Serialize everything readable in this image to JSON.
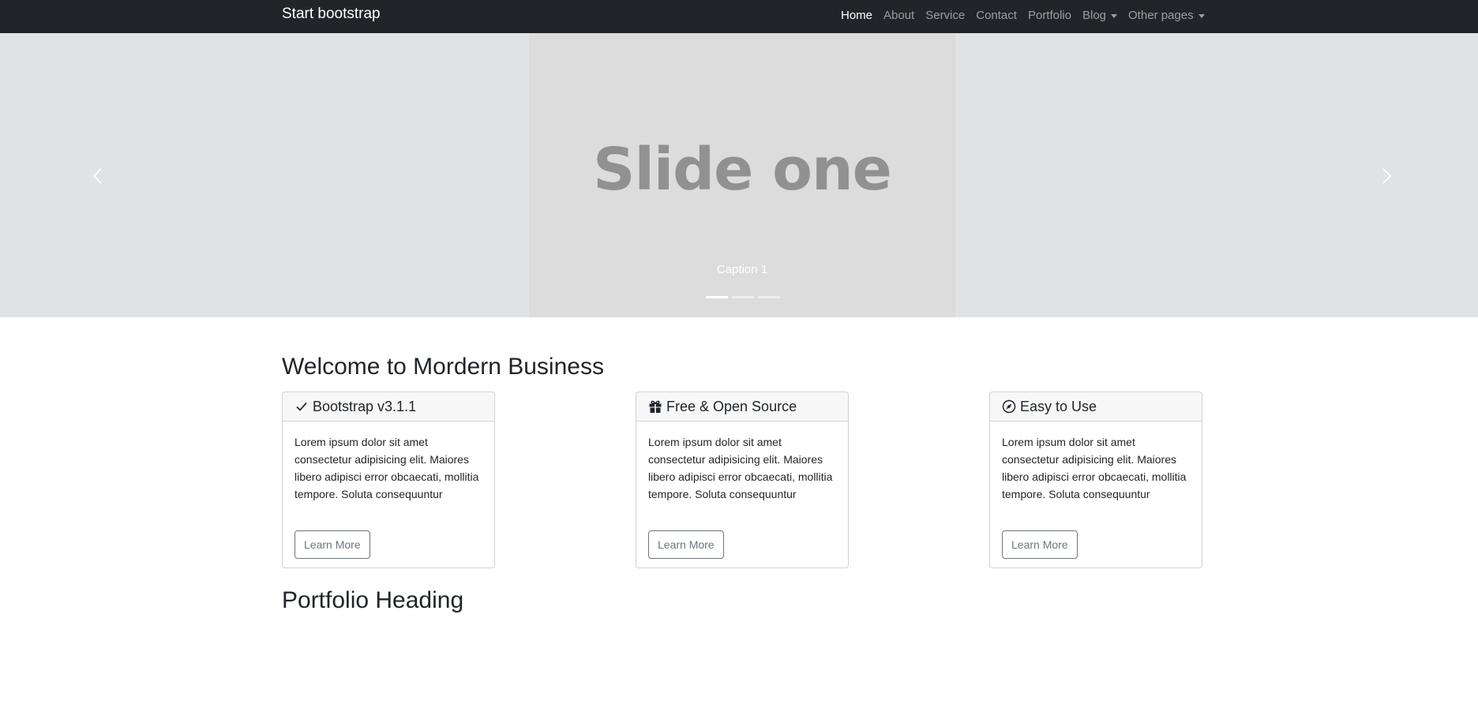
{
  "navbar": {
    "brand": "Start bootstrap",
    "items": [
      {
        "label": "Home",
        "active": true,
        "dropdown": false
      },
      {
        "label": "About",
        "active": false,
        "dropdown": false
      },
      {
        "label": "Service",
        "active": false,
        "dropdown": false
      },
      {
        "label": "Contact",
        "active": false,
        "dropdown": false
      },
      {
        "label": "Portfolio",
        "active": false,
        "dropdown": false
      },
      {
        "label": "Blog",
        "active": false,
        "dropdown": true
      },
      {
        "label": "Other pages",
        "active": false,
        "dropdown": true
      }
    ]
  },
  "carousel": {
    "slide_text": "Slide one",
    "caption": "Caption 1",
    "slide_count": 3,
    "active_index": 0,
    "prev_icon": "chevron-left-icon",
    "next_icon": "chevron-right-icon"
  },
  "main": {
    "heading": "Welcome to Mordern Business",
    "cards": [
      {
        "icon": "check-icon",
        "title": "Bootstrap v3.1.1",
        "text": "Lorem ipsum dolor sit amet consectetur adipisicing elit. Maiores libero adipisci error obcaecati, mollitia tempore. Soluta consequuntur",
        "button": "Learn More"
      },
      {
        "icon": "gift-icon",
        "title": "Free & Open Source",
        "text": "Lorem ipsum dolor sit amet consectetur adipisicing elit. Maiores libero adipisci error obcaecati, mollitia tempore. Soluta consequuntur",
        "button": "Learn More"
      },
      {
        "icon": "compass-icon",
        "title": "Easy to Use",
        "text": "Lorem ipsum dolor sit amet consectetur adipisicing elit. Maiores libero adipisci error obcaecati, mollitia tempore. Soluta consequuntur",
        "button": "Learn More"
      }
    ],
    "portfolio_heading": "Portfolio Heading"
  },
  "colors": {
    "navbar_bg": "#212529",
    "carousel_bg": "#e1e2e4",
    "slide_bg": "#dcdcdc",
    "slide_text": "#919191",
    "button_border": "#6c757d"
  }
}
